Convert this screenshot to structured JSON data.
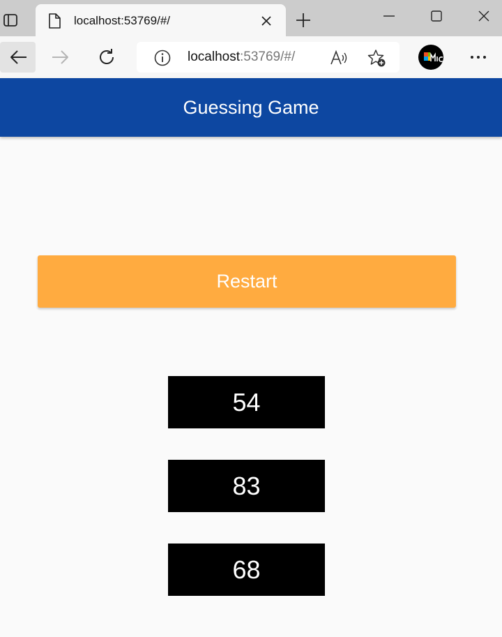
{
  "browser": {
    "tab": {
      "title": "localhost:53769/#/"
    },
    "address": {
      "host": "localhost",
      "rest": ":53769/#/"
    },
    "colors": {
      "tabstrip": "#cccccc",
      "toolbar": "#f7f7f7"
    },
    "icons": [
      "tab-actions-icon",
      "page-icon",
      "close-icon",
      "plus-icon",
      "minimize-icon",
      "maximize-icon",
      "close-window-icon",
      "back-arrow-icon",
      "forward-arrow-icon",
      "refresh-icon",
      "info-icon",
      "read-aloud-icon",
      "favorites-add-icon",
      "profile-avatar",
      "more-dots-icon"
    ]
  },
  "app": {
    "title": "Guessing Game",
    "restart_label": "Restart",
    "guesses": [
      "54",
      "83",
      "68"
    ],
    "colors": {
      "appbar": "#0d47a1",
      "button": "#ffab40",
      "tile": "#000000",
      "background": "#fafafa"
    }
  }
}
